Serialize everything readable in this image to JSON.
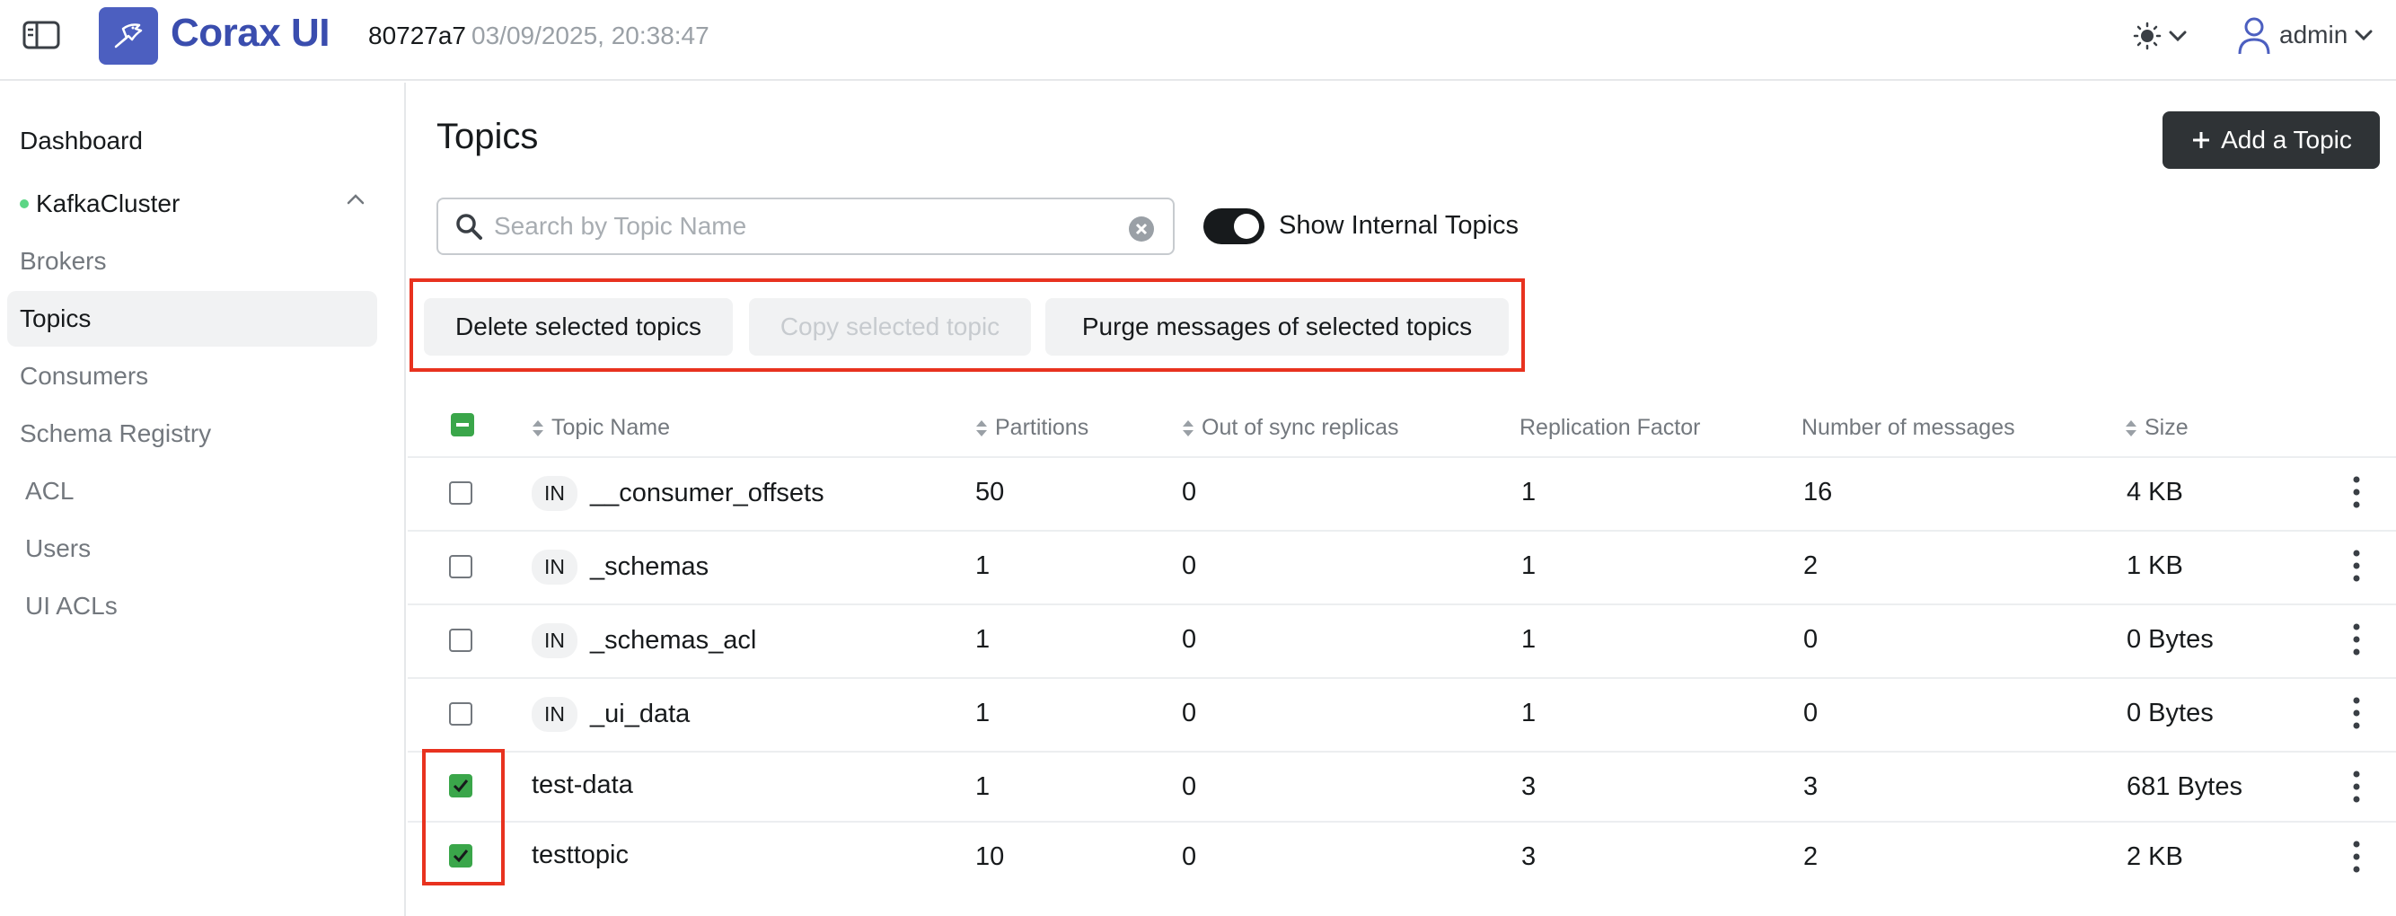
{
  "header": {
    "brand": "Corax UI",
    "version": "80727a7",
    "timestamp": "03/09/2025, 20:38:47",
    "user": "admin"
  },
  "sidebar": {
    "items": [
      {
        "label": "Dashboard"
      },
      {
        "label": "KafkaCluster"
      },
      {
        "label": "Brokers"
      },
      {
        "label": "Topics"
      },
      {
        "label": "Consumers"
      },
      {
        "label": "Schema Registry"
      },
      {
        "label": "ACL"
      },
      {
        "label": "Users"
      },
      {
        "label": "UI ACLs"
      }
    ],
    "cluster_status_color": "#5cd685"
  },
  "main": {
    "title": "Topics",
    "add_button": "Add a Topic",
    "search_placeholder": "Search by Topic Name",
    "toggle_label": "Show Internal Topics",
    "toggle_on": true,
    "bulk_actions": {
      "delete": "Delete selected topics",
      "copy": "Copy selected topic",
      "purge": "Purge messages of selected topics"
    }
  },
  "table": {
    "columns": [
      "Topic Name",
      "Partitions",
      "Out of sync replicas",
      "Replication Factor",
      "Number of messages",
      "Size"
    ],
    "internal_badge": "IN",
    "rows": [
      {
        "name": "__consumer_offsets",
        "internal": true,
        "partitions": "50",
        "out_of_sync": "0",
        "replication": "1",
        "messages": "16",
        "size": "4 KB",
        "checked": false
      },
      {
        "name": "_schemas",
        "internal": true,
        "partitions": "1",
        "out_of_sync": "0",
        "replication": "1",
        "messages": "2",
        "size": "1 KB",
        "checked": false
      },
      {
        "name": "_schemas_acl",
        "internal": true,
        "partitions": "1",
        "out_of_sync": "0",
        "replication": "1",
        "messages": "0",
        "size": "0 Bytes",
        "checked": false
      },
      {
        "name": "_ui_data",
        "internal": true,
        "partitions": "1",
        "out_of_sync": "0",
        "replication": "1",
        "messages": "0",
        "size": "0 Bytes",
        "checked": false
      },
      {
        "name": "test-data",
        "internal": false,
        "partitions": "1",
        "out_of_sync": "0",
        "replication": "3",
        "messages": "3",
        "size": "681 Bytes",
        "checked": true
      },
      {
        "name": "testtopic",
        "internal": false,
        "partitions": "10",
        "out_of_sync": "0",
        "replication": "3",
        "messages": "2",
        "size": "2 KB",
        "checked": true
      }
    ]
  },
  "colors": {
    "brand": "#3a4dae",
    "checkbox_checked": "#3aa64a",
    "annotation": "#e8321f"
  }
}
